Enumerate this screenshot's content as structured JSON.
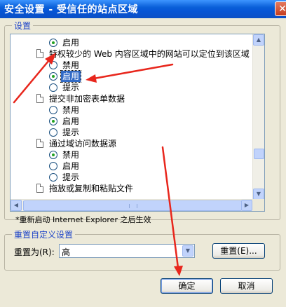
{
  "window": {
    "title": "安全设置 - 受信任的站点区域",
    "close_glyph": "✕"
  },
  "settings_group": {
    "legend": "设置"
  },
  "tree": [
    {
      "type": "option",
      "label": "启用",
      "checked": true
    },
    {
      "type": "setting",
      "label": "特权较少的 Web 内容区域中的网站可以定位到该区域"
    },
    {
      "type": "option",
      "label": "禁用",
      "checked": false
    },
    {
      "type": "option",
      "label": "启用",
      "checked": true,
      "selected": true
    },
    {
      "type": "option",
      "label": "提示",
      "checked": false
    },
    {
      "type": "setting",
      "label": "提交非加密表单数据"
    },
    {
      "type": "option",
      "label": "禁用",
      "checked": false
    },
    {
      "type": "option",
      "label": "启用",
      "checked": true
    },
    {
      "type": "option",
      "label": "提示",
      "checked": false
    },
    {
      "type": "setting",
      "label": "通过域访问数据源"
    },
    {
      "type": "option",
      "label": "禁用",
      "checked": true
    },
    {
      "type": "option",
      "label": "启用",
      "checked": false
    },
    {
      "type": "option",
      "label": "提示",
      "checked": false
    },
    {
      "type": "setting",
      "label": "拖放或复制和粘贴文件"
    }
  ],
  "note": "*重新启动 Internet Explorer 之后生效",
  "custom_group": {
    "legend": "重置自定义设置",
    "reset_to_label": "重置为(R):",
    "reset_to_value": "高",
    "reset_button": "重置(E)..."
  },
  "footer": {
    "ok": "确定",
    "cancel": "取消"
  },
  "colors": {
    "title_bar": "#0a5fd8",
    "selection": "#316ac5",
    "annotation_arrow": "#e8261c"
  }
}
